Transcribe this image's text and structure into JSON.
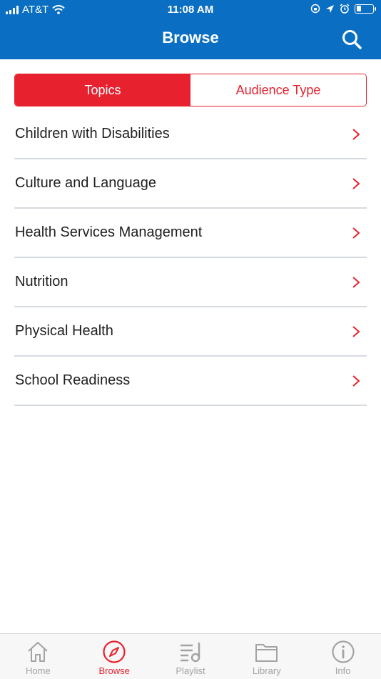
{
  "status_bar": {
    "carrier": "AT&T",
    "time": "11:08 AM",
    "battery_level": 0.3
  },
  "header": {
    "title": "Browse",
    "search_icon": "search-icon"
  },
  "segment": {
    "tabs": [
      {
        "label": "Topics",
        "active": true
      },
      {
        "label": "Audience Type",
        "active": false
      }
    ]
  },
  "topics": [
    {
      "label": "Children with Disabilities"
    },
    {
      "label": "Culture and Language"
    },
    {
      "label": "Health Services Management"
    },
    {
      "label": "Nutrition"
    },
    {
      "label": "Physical Health"
    },
    {
      "label": "School Readiness"
    }
  ],
  "tab_bar": {
    "items": [
      {
        "label": "Home",
        "icon": "home-icon",
        "active": false
      },
      {
        "label": "Browse",
        "icon": "compass-icon",
        "active": true
      },
      {
        "label": "Playlist",
        "icon": "playlist-icon",
        "active": false
      },
      {
        "label": "Library",
        "icon": "folder-icon",
        "active": false
      },
      {
        "label": "Info",
        "icon": "info-icon",
        "active": false
      }
    ]
  },
  "colors": {
    "brand_blue": "#0a6fc2",
    "accent_red": "#e8212e",
    "divider": "#d6dbe0",
    "inactive_tab": "#a3a3a3"
  }
}
